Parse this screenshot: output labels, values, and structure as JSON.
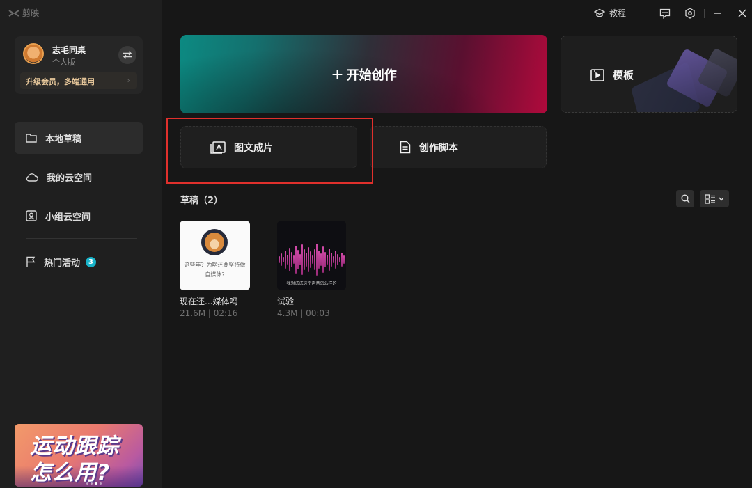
{
  "app": {
    "name": "剪映"
  },
  "user": {
    "name": "志毛同桌",
    "edition": "个人版",
    "upgrade_label": "升级会员，多端通用",
    "upgrade_arrow": "›"
  },
  "sidebar": {
    "items": [
      {
        "label": "本地草稿",
        "icon": "folder-icon"
      },
      {
        "label": "我的云空间",
        "icon": "cloud-icon"
      },
      {
        "label": "小组云空间",
        "icon": "team-icon"
      },
      {
        "label": "热门活动",
        "icon": "flag-icon",
        "badge": "3"
      }
    ]
  },
  "banner": {
    "line1": "运动跟踪",
    "line2": "怎么用?"
  },
  "topbar": {
    "tutorial_label": "教程"
  },
  "main": {
    "start_label": "开始创作",
    "start_plus": "+",
    "template_label": "模板",
    "image_text_label": "图文成片",
    "script_label": "创作脚本",
    "drafts_title": "草稿（2）"
  },
  "drafts": [
    {
      "name": "现在还...媒体吗",
      "meta": "21.6M | 02:16",
      "caption_line1": "这些年？为啥还要坚持做",
      "caption_line2": "自媒体?"
    },
    {
      "name": "试验",
      "meta": "4.3M | 00:03",
      "caption": "我想试试这个声音怎么样的"
    }
  ],
  "colors": {
    "accent_badge": "#18b3c9",
    "highlight_border": "#e0302c",
    "upgrade_text": "#e7c79a"
  }
}
